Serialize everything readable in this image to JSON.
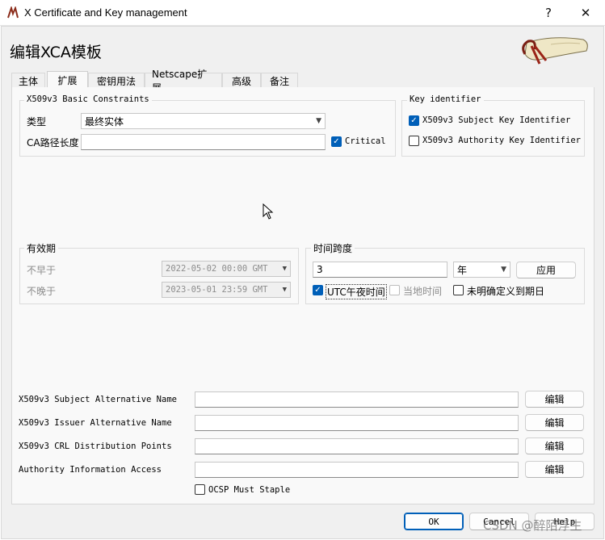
{
  "window": {
    "title": "X Certificate and Key management",
    "help": "?",
    "close": "✕"
  },
  "header": {
    "title": "编辑XCA模板"
  },
  "tabs": [
    {
      "label": "主体"
    },
    {
      "label": "扩展"
    },
    {
      "label": "密钥用法"
    },
    {
      "label": "Netscape扩展"
    },
    {
      "label": "高级"
    },
    {
      "label": "备注"
    }
  ],
  "basic_constraints": {
    "title": "X509v3 Basic Constraints",
    "type_label": "类型",
    "type_value": "最终实体",
    "ca_path_label": "CA路径长度",
    "ca_path_value": "",
    "critical_label": "Critical",
    "critical_checked": true
  },
  "key_identifier": {
    "title": "Key identifier",
    "subject_key_label": "X509v3 Subject Key Identifier",
    "subject_key_checked": true,
    "authority_key_label": "X509v3 Authority Key Identifier",
    "authority_key_checked": false
  },
  "validity": {
    "title": "有效期",
    "not_before_label": "不早于",
    "not_before_value": "2022-05-02 00:00 GMT",
    "not_after_label": "不晚于",
    "not_after_value": "2023-05-01 23:59 GMT"
  },
  "time_range": {
    "title": "时间跨度",
    "amount": "3",
    "unit": "年",
    "apply_label": "应用",
    "utc_midnight_label": "UTC午夜时间",
    "utc_midnight_checked": true,
    "local_time_label": "当地时间",
    "local_time_checked": false,
    "no_expiry_label": "未明确定义到期日",
    "no_expiry_checked": false
  },
  "extensions": [
    {
      "label": "X509v3 Subject Alternative Name",
      "value": "",
      "edit_label": "编辑"
    },
    {
      "label": "X509v3 Issuer Alternative Name",
      "value": "",
      "edit_label": "编辑"
    },
    {
      "label": "X509v3 CRL Distribution Points",
      "value": "",
      "edit_label": "编辑"
    },
    {
      "label": "Authority Information Access",
      "value": "",
      "edit_label": "编辑"
    }
  ],
  "ocsp": {
    "label": "OCSP Must Staple",
    "checked": false
  },
  "footer": {
    "ok_label": "OK",
    "cancel_label": "Cancel",
    "help_label": "Help"
  },
  "watermark": "CSDN @醉陌浮生"
}
